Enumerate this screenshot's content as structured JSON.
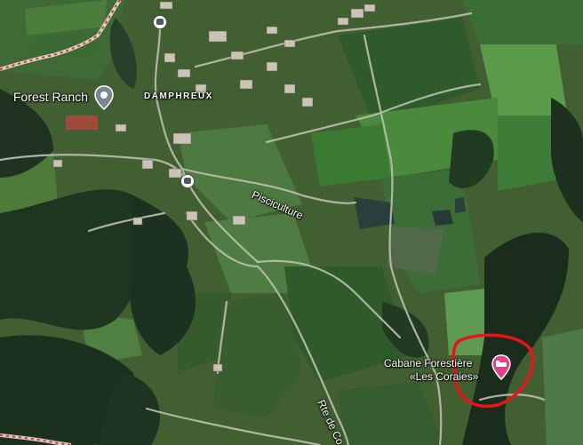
{
  "map": {
    "labels": {
      "forest_ranch": "Forest Ranch",
      "village": "DAMPHREUX",
      "road_pisciculture": "Pisciculture",
      "cabane_line1": "Cabane Forestière",
      "cabane_line2": "«Les Coraies»",
      "road_rte": "Rte de Co"
    },
    "icons": {
      "forest_ranch_pin": "location-pin-icon",
      "cabane_pin": "hotel-bed-pin-icon",
      "bus_stop": "bus-stop-icon"
    },
    "colors": {
      "annotation_circle": "#e8141c",
      "cabane_pin": "#e4418a",
      "poi_pin": "#7a8691",
      "border_line": "#f2d6d0"
    }
  }
}
